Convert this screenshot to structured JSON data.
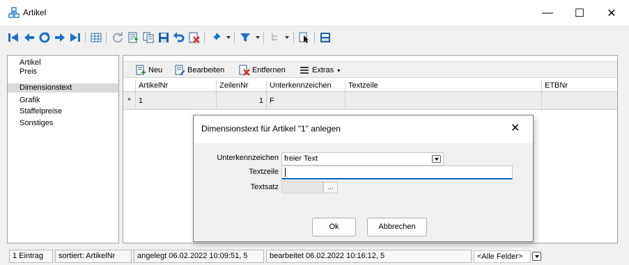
{
  "window": {
    "title": "Artikel",
    "minimize": "—",
    "maximize": "☐",
    "close": "✕"
  },
  "sidebar": {
    "items": [
      {
        "label": "Artikel"
      },
      {
        "label": "Preis"
      },
      {
        "label": "Dimensionstext",
        "selected": true
      },
      {
        "label": "Grafik"
      },
      {
        "label": "Staffelpreise"
      },
      {
        "label": "Sonstiges"
      }
    ]
  },
  "subtoolbar": {
    "new_label": "Neu",
    "edit_label": "Bearbeiten",
    "remove_label": "Entfernen",
    "extras_label": "Extras",
    "extras_arrow": "▾"
  },
  "grid": {
    "columns": [
      "ArtikelNr",
      "ZeilenNr",
      "Unterkennzeichen",
      "Textzeile",
      "ETBNr"
    ],
    "row": {
      "marker": "*",
      "artikelnr": "1",
      "zeilennr": "1",
      "unterkennzeichen": "F",
      "textzeile": "",
      "etbnr": ""
    }
  },
  "dialog": {
    "title": "Dimensionstext für Artikel \"1\" anlegen",
    "close": "✕",
    "unterkennzeichen_label": "Unterkennzeichen",
    "unterkennzeichen_value": "freier Text",
    "textzeile_label": "Textzeile",
    "textzeile_value": "",
    "textsatz_label": "Textsatz",
    "textsatz_btn": "...",
    "ok_label": "Ok",
    "cancel_label": "Abbrechen"
  },
  "statusbar": {
    "count": "1 Eintrag",
    "sorted": "sortiert: ArtikelNr",
    "created": "angelegt 06.02.2022 10:09:51, 5",
    "edited": "bearbeitet 06.02.2022 10:16:12, 5",
    "field_filter": "<Alle Felder>"
  },
  "colors": {
    "accent": "#0067c0",
    "nav_blue": "#1a73c8",
    "window_bg": "#f0f0f0",
    "selection": "#d9d9d9"
  }
}
